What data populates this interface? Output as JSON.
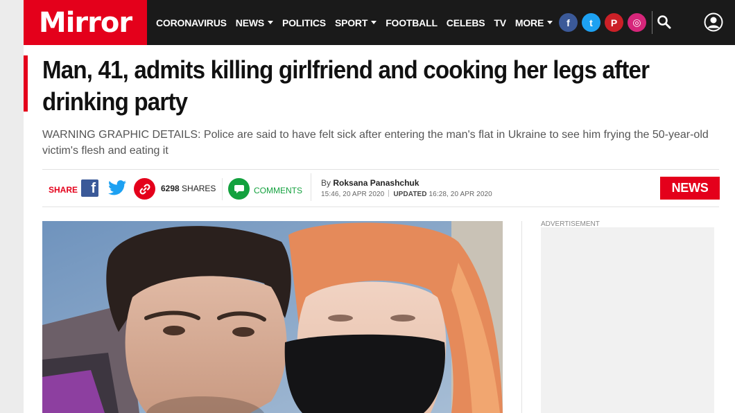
{
  "brand": {
    "logo": "Mirror",
    "accent": "#e4001b"
  },
  "nav": {
    "items": [
      {
        "label": "CORONAVIRUS",
        "dropdown": false
      },
      {
        "label": "NEWS",
        "dropdown": true
      },
      {
        "label": "POLITICS",
        "dropdown": false
      },
      {
        "label": "SPORT",
        "dropdown": true
      },
      {
        "label": "FOOTBALL",
        "dropdown": false
      },
      {
        "label": "CELEBS",
        "dropdown": false
      },
      {
        "label": "TV",
        "dropdown": false
      },
      {
        "label": "MORE",
        "dropdown": true
      }
    ],
    "social": [
      {
        "icon": "facebook-icon",
        "glyph": "f"
      },
      {
        "icon": "twitter-icon",
        "glyph": "t"
      },
      {
        "icon": "pinterest-icon",
        "glyph": "P"
      },
      {
        "icon": "instagram-icon",
        "glyph": "◎"
      }
    ]
  },
  "article": {
    "headline": "Man, 41, admits killing girlfriend and cooking her legs after drinking party",
    "standfirst": "WARNING GRAPHIC DETAILS: Police are said to have felt sick after entering the man's flat in Ukraine to see him frying the 50-year-old victim's flesh and eating it",
    "share": {
      "label": "SHARE",
      "count": "6298",
      "count_suffix": "SHARES",
      "comments_label": "COMMENTS"
    },
    "byline": {
      "prefix": "By",
      "author": "Roksana Panashchuk",
      "published": "15:46, 20 APR 2020",
      "updated_label": "UPDATED",
      "updated": "16:28, 20 APR 2020"
    },
    "section_badge": "NEWS"
  },
  "sidebar": {
    "ad_label": "ADVERTISEMENT"
  }
}
